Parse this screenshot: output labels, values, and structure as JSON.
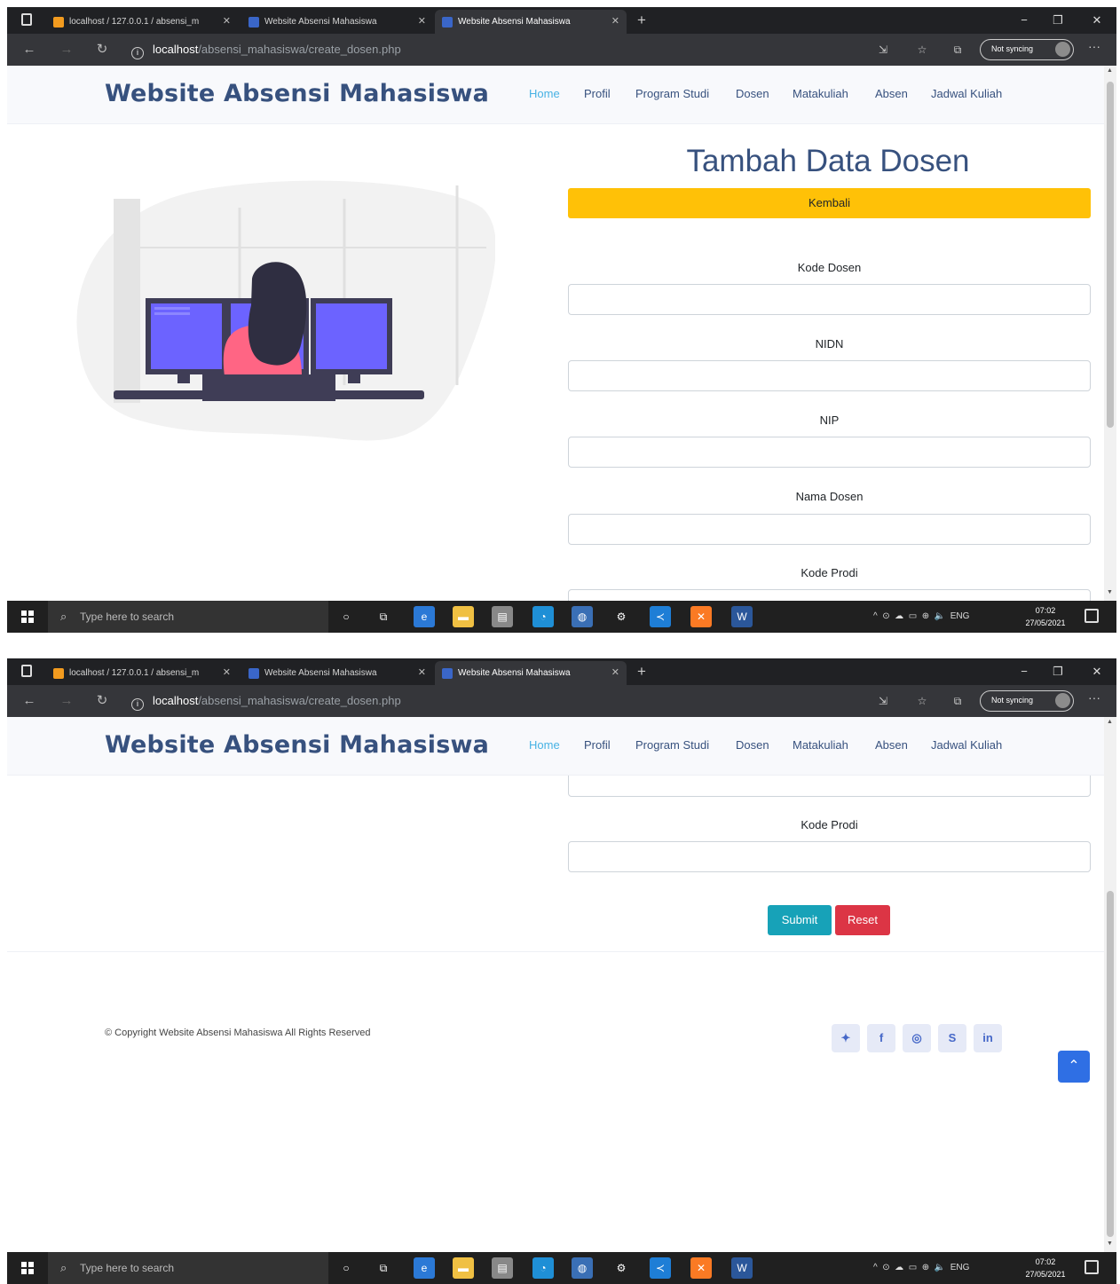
{
  "browser": {
    "tabs": [
      {
        "label": "localhost / 127.0.0.1 / absensi_m",
        "favicon": "phpmyadmin-icon"
      },
      {
        "label": "Website Absensi Mahasiswa",
        "favicon": "page-icon"
      },
      {
        "label": "Website Absensi Mahasiswa",
        "favicon": "page-icon",
        "active": true
      }
    ],
    "url_host": "localhost",
    "url_path": "/absensi_mahasiswa/create_dosen.php",
    "sync_label": "Not syncing"
  },
  "site": {
    "brand": "Website Absensi Mahasiswa",
    "nav": [
      "Home",
      "Profil",
      "Program Studi",
      "Dosen",
      "Matakuliah",
      "Absen",
      "Jadwal Kuliah"
    ],
    "active_nav": "Home"
  },
  "form": {
    "title": "Tambah Data Dosen",
    "back_label": "Kembali",
    "fields": [
      "Kode Dosen",
      "NIDN",
      "NIP",
      "Nama Dosen",
      "Kode Prodi"
    ],
    "submit_label": "Submit",
    "reset_label": "Reset"
  },
  "footer": {
    "copyright": "© Copyright Website Absensi Mahasiswa All Rights Reserved",
    "social": [
      "twitter-icon",
      "facebook-icon",
      "instagram-icon",
      "skype-icon",
      "linkedin-icon"
    ]
  },
  "taskbar": {
    "search_placeholder": "Type here to search",
    "language": "ENG",
    "time": "07:02",
    "date": "27/05/2021"
  },
  "colors": {
    "brand": "#37517e",
    "accent": "#47b2e4",
    "back_button": "#ffc107",
    "submit": "#17a2b8",
    "reset": "#dc3545",
    "illustration_screen": "#6c63ff",
    "illustration_shirt": "#ff6584"
  }
}
